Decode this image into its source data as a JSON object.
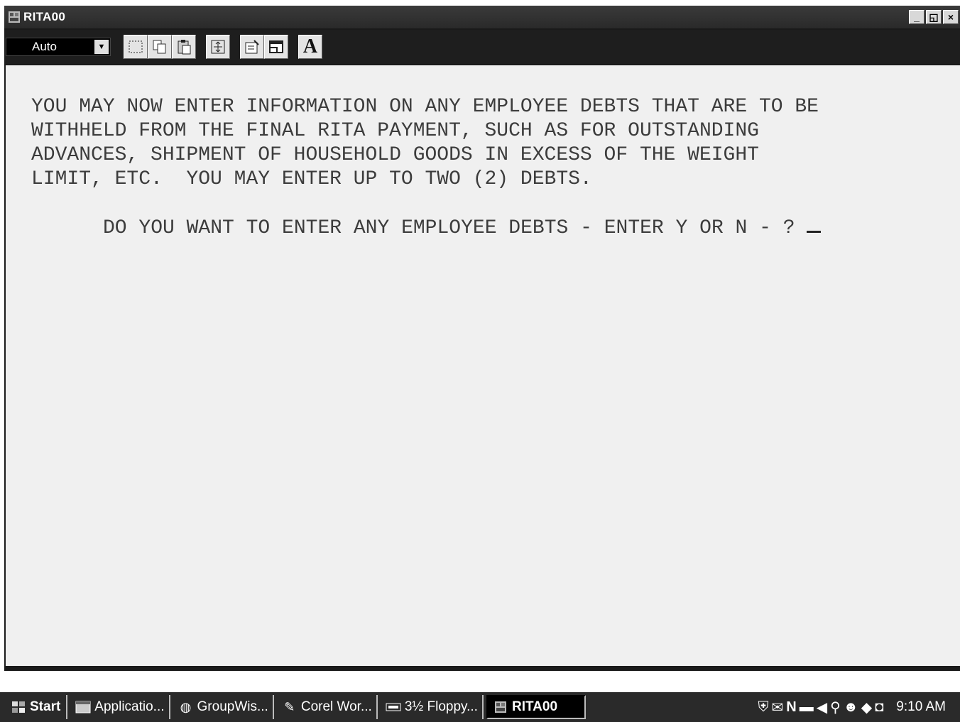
{
  "window": {
    "title": "RITA00",
    "icon": "mainframe-app-icon",
    "controls": {
      "minimize": "_",
      "restore": "◱",
      "close": "×"
    }
  },
  "toolbar": {
    "font_size_select": {
      "value": "Auto"
    },
    "buttons": [
      {
        "name": "mark-button",
        "icon": "dotted-select-icon"
      },
      {
        "name": "copy-button",
        "icon": "copy-icon"
      },
      {
        "name": "paste-button",
        "icon": "paste-icon"
      },
      {
        "name": "full-screen-button",
        "icon": "fullscreen-icon"
      },
      {
        "name": "properties-button",
        "icon": "properties-icon"
      },
      {
        "name": "background-button",
        "icon": "window-icon"
      },
      {
        "name": "font-button",
        "icon": "font-icon",
        "label": "A"
      }
    ]
  },
  "terminal": {
    "lines": [
      "YOU MAY NOW ENTER INFORMATION ON ANY EMPLOYEE DEBTS THAT ARE TO BE",
      "WITHHELD FROM THE FINAL RITA PAYMENT, SUCH AS FOR OUTSTANDING",
      "ADVANCES, SHIPMENT OF HOUSEHOLD GOODS IN EXCESS OF THE WEIGHT",
      "LIMIT, ETC.  YOU MAY ENTER UP TO TWO (2) DEBTS."
    ],
    "prompt": "DO YOU WANT TO ENTER ANY EMPLOYEE DEBTS - ENTER Y OR N - ? ",
    "input_value": ""
  },
  "taskbar": {
    "start_label": "Start",
    "tasks": [
      {
        "label": "Applicatio...",
        "icon": "application-icon"
      },
      {
        "label": "GroupWis...",
        "icon": "groupwise-icon"
      },
      {
        "label": "Corel Wor...",
        "icon": "corel-icon"
      },
      {
        "label": "3½ Floppy...",
        "icon": "floppy-icon"
      },
      {
        "label": "RITA00",
        "icon": "mainframe-app-icon",
        "active": true
      }
    ],
    "tray_icons": [
      "shield-icon",
      "chart-icon",
      "netware-icon",
      "network-icon",
      "volume-icon",
      "search-icon",
      "user-icon",
      "chat-icon",
      "scheduler-icon"
    ],
    "clock": "9:10 AM"
  }
}
